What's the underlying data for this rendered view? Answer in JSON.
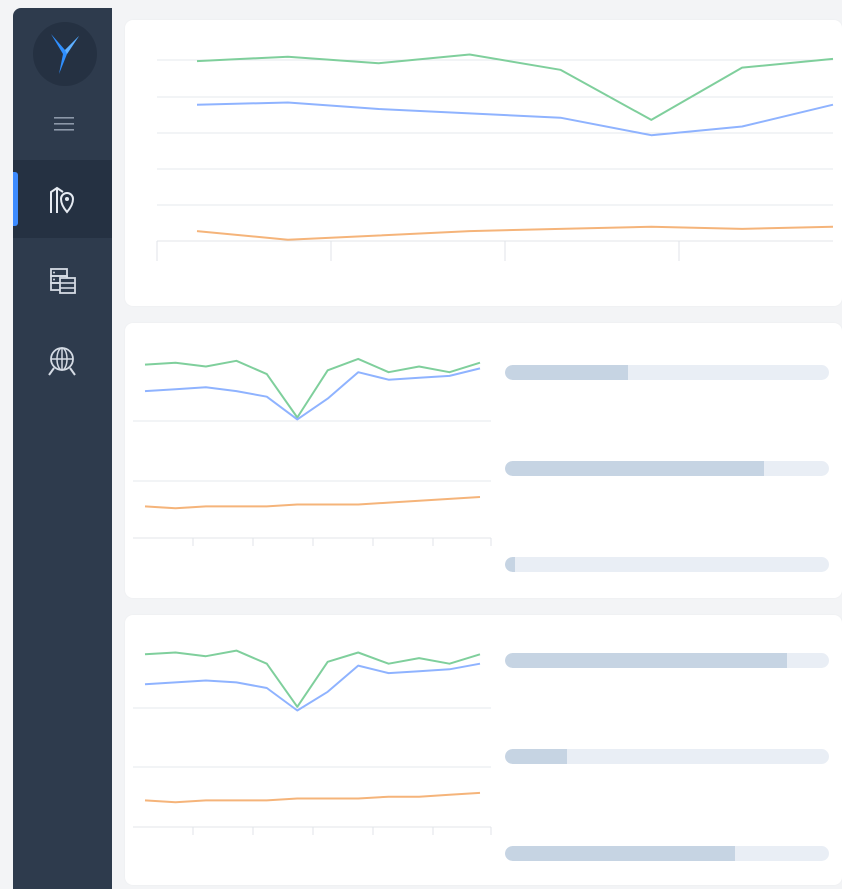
{
  "colors": {
    "sidebar_bg": "#2e3b4d",
    "sidebar_active": "#253142",
    "accent": "#3d8bff",
    "series_green": "#7fcf9c",
    "series_blue": "#8fb3ff",
    "series_orange": "#f5b47a",
    "progress_track": "#e9eef5",
    "progress_fill": "#c6d4e3"
  },
  "sidebar": {
    "logo_icon": "bird-logo-icon",
    "menu_icon": "hamburger-icon",
    "items": [
      {
        "icon": "map-location-icon",
        "active": true
      },
      {
        "icon": "server-database-icon",
        "active": false
      },
      {
        "icon": "globe-search-icon",
        "active": false
      }
    ]
  },
  "chart_data": [
    {
      "type": "line",
      "x": [
        0,
        1,
        2,
        3,
        4,
        5,
        6,
        7
      ],
      "series": [
        {
          "values": [
            83,
            85,
            82,
            86,
            79,
            56,
            80,
            84
          ]
        },
        {
          "values": [
            63,
            64,
            61,
            59,
            57,
            49,
            53,
            63
          ]
        },
        {
          "values": [
            5,
            1,
            3,
            5,
            6,
            7,
            6,
            7
          ]
        }
      ],
      "ylim": [
        0,
        100
      ],
      "grid": true
    },
    {
      "type": "line",
      "x": [
        0,
        1,
        2,
        3,
        4,
        5,
        6,
        7,
        8,
        9,
        10,
        11
      ],
      "series": [
        {
          "values": [
            88,
            89,
            87,
            90,
            83,
            60,
            85,
            91,
            84,
            87,
            84,
            89
          ]
        },
        {
          "values": [
            74,
            75,
            76,
            74,
            71,
            59,
            70,
            84,
            80,
            81,
            82,
            86
          ]
        },
        {
          "values": [
            13,
            12,
            13,
            13,
            13,
            14,
            14,
            14,
            15,
            16,
            17,
            18
          ]
        }
      ],
      "ylim": [
        0,
        110
      ],
      "grid": true
    },
    {
      "type": "line",
      "x": [
        0,
        1,
        2,
        3,
        4,
        5,
        6,
        7,
        8,
        9,
        10,
        11
      ],
      "series": [
        {
          "values": [
            89,
            90,
            88,
            91,
            84,
            61,
            85,
            90,
            84,
            87,
            84,
            89
          ]
        },
        {
          "values": [
            73,
            74,
            75,
            74,
            71,
            59,
            69,
            83,
            79,
            80,
            81,
            84
          ]
        },
        {
          "values": [
            11,
            10,
            11,
            11,
            11,
            12,
            12,
            12,
            13,
            13,
            14,
            15
          ]
        }
      ],
      "ylim": [
        0,
        110
      ],
      "grid": true
    }
  ],
  "progress_bars": [
    {
      "value": 0.38
    },
    {
      "value": 0.8
    },
    {
      "value": 0.03
    },
    {
      "value": 0.87
    },
    {
      "value": 0.19
    },
    {
      "value": 0.71
    }
  ]
}
